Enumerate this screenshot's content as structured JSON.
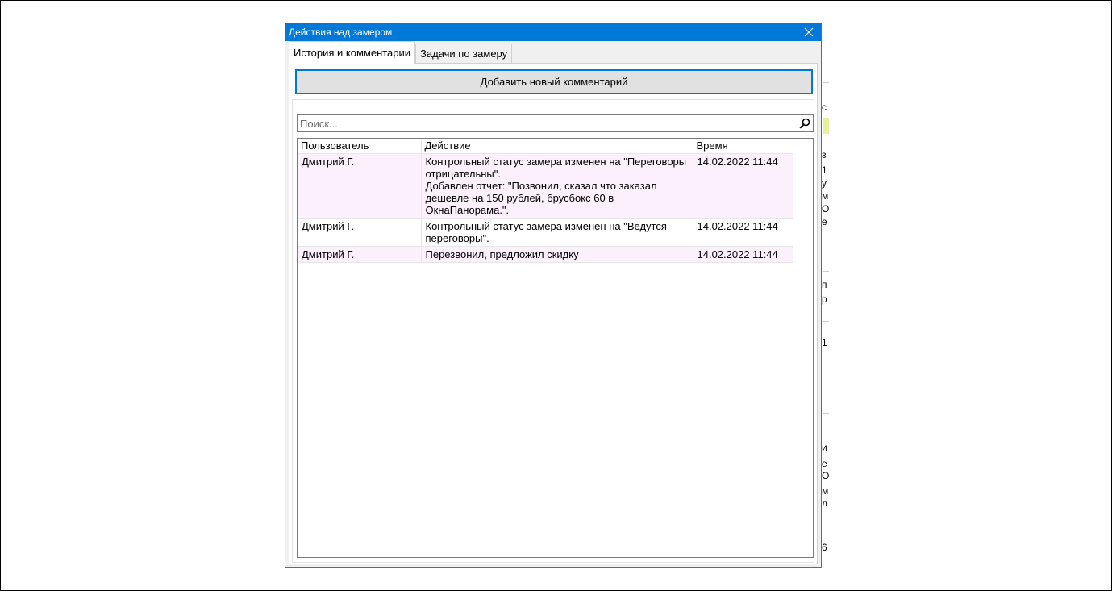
{
  "dialog": {
    "title": "Действия над замером",
    "tabs": [
      {
        "label": "История и комментарии",
        "active": true
      },
      {
        "label": "Задачи по замеру",
        "active": false
      }
    ],
    "add_button_label": "Добавить новый комментарий",
    "search": {
      "placeholder": "Поиск...",
      "value": ""
    },
    "table": {
      "columns": [
        "Пользователь",
        "Действие",
        "Время"
      ],
      "rows": [
        {
          "user": "Дмитрий Г.",
          "action": "Контрольный статус замера изменен на \"Переговоры\nотрицательны\".\nДобавлен отчет: \"Позвонил, сказал что заказал\nдешевле на 150 рублей, брусбокс 60 в\nОкнаПанорама.\".",
          "time": "14.02.2022 11:44"
        },
        {
          "user": "Дмитрий Г.",
          "action": "Контрольный статус замера изменен на \"Ведутся\nпереговоры\".",
          "time": "14.02.2022 11:44"
        },
        {
          "user": "Дмитрий Г.",
          "action": "Перезвонил, предложил скидку",
          "time": "14.02.2022 11:44"
        }
      ]
    }
  },
  "background_fragments": [
    "с",
    "з",
    "1",
    "у",
    "м",
    "О",
    "е",
    "п",
    "р",
    "о",
    "1",
    "и",
    "е",
    "О",
    "м",
    "л",
    "6"
  ],
  "colors": {
    "titlebar": "#0078d7",
    "row_highlight": "#fcf0fc",
    "button_border": "#0078d7"
  }
}
